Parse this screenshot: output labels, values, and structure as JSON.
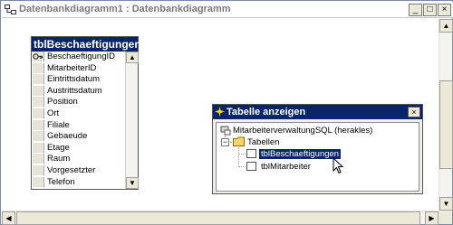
{
  "window": {
    "title": "Datenbankdiagramm1 : Datenbankdiagramm",
    "minimize_glyph": "_",
    "maximize_glyph": "□",
    "close_glyph": "×"
  },
  "scroll": {
    "up_glyph": "▲",
    "down_glyph": "▼",
    "left_glyph": "◀",
    "right_glyph": "▶"
  },
  "table": {
    "name": "tblBeschaeftigungen",
    "fields": [
      {
        "name": "BeschaeftigungID",
        "primary_key": true
      },
      {
        "name": "MitarbeiterID",
        "primary_key": false
      },
      {
        "name": "Eintrittsdatum",
        "primary_key": false
      },
      {
        "name": "Austrittsdatum",
        "primary_key": false
      },
      {
        "name": "Position",
        "primary_key": false
      },
      {
        "name": "Ort",
        "primary_key": false
      },
      {
        "name": "Filiale",
        "primary_key": false
      },
      {
        "name": "Gebaeude",
        "primary_key": false
      },
      {
        "name": "Etage",
        "primary_key": false
      },
      {
        "name": "Raum",
        "primary_key": false
      },
      {
        "name": "Vorgesetzter",
        "primary_key": false
      },
      {
        "name": "Telefon",
        "primary_key": false
      }
    ],
    "key_icon": "key-icon"
  },
  "dialog": {
    "title": "Tabelle anzeigen",
    "close_glyph": "×",
    "tree": {
      "server": "MitarbeiterverwaltungSQL (herakles)",
      "folder": "Tabellen",
      "folder_expander": "−",
      "tables": [
        {
          "name": "tblBeschaeftigungen",
          "selected": true
        },
        {
          "name": "tblMitarbeiter",
          "selected": false
        }
      ]
    }
  },
  "colors": {
    "title_active": "#0a246a",
    "window_border": "#7a8aa8",
    "dialog_bg": "#f0efe8"
  }
}
